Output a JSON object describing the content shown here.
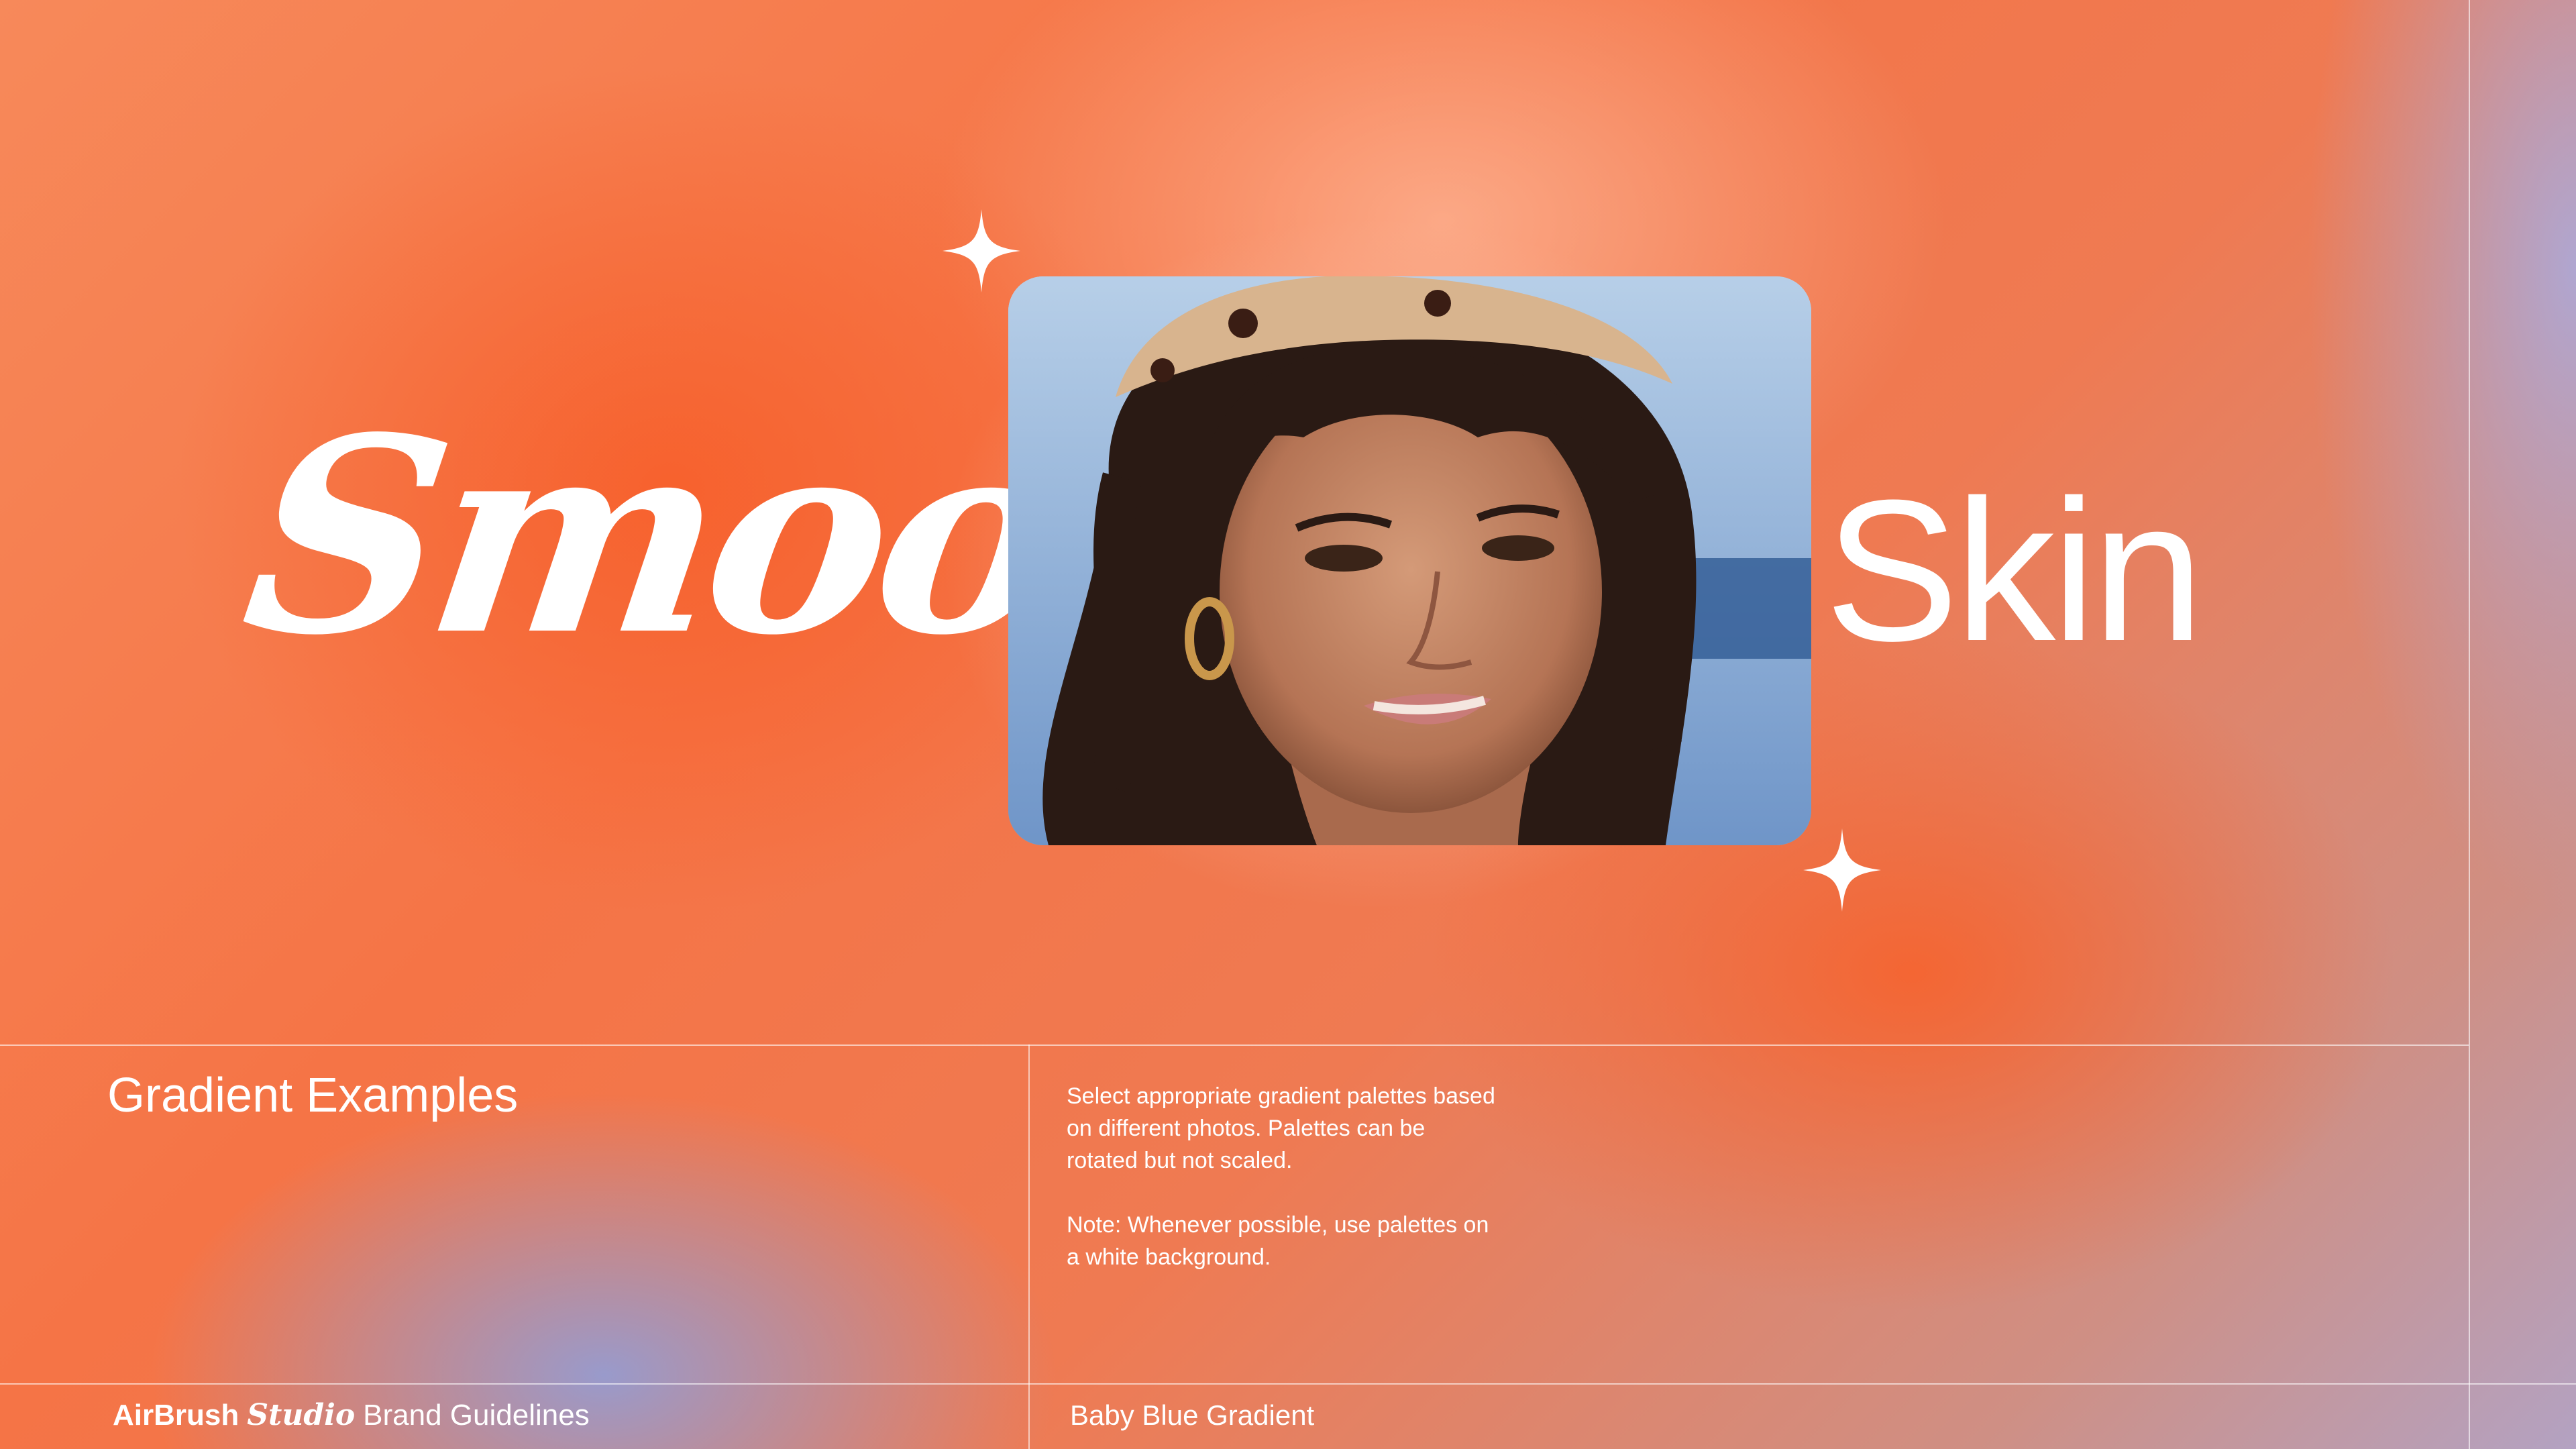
{
  "hero": {
    "word_script": "Smooth",
    "word_sans": "Skin"
  },
  "section": {
    "title": "Gradient Examples",
    "description_1": "Select appropriate gradient palettes based on different photos. Palettes can be rotated but not scaled.",
    "description_2": "Note: Whenever possible, use palettes on a white background."
  },
  "footer": {
    "brand_name": "AirBrush",
    "brand_script": "Studio",
    "brand_suffix": "Brand Guidelines",
    "gradient_label": "Baby Blue Gradient"
  },
  "colors": {
    "orange": "#f5673a",
    "peach": "#f9a98a",
    "baby_blue": "#94a0d4",
    "text": "#ffffff"
  },
  "icons": [
    "sparkle-icon"
  ]
}
